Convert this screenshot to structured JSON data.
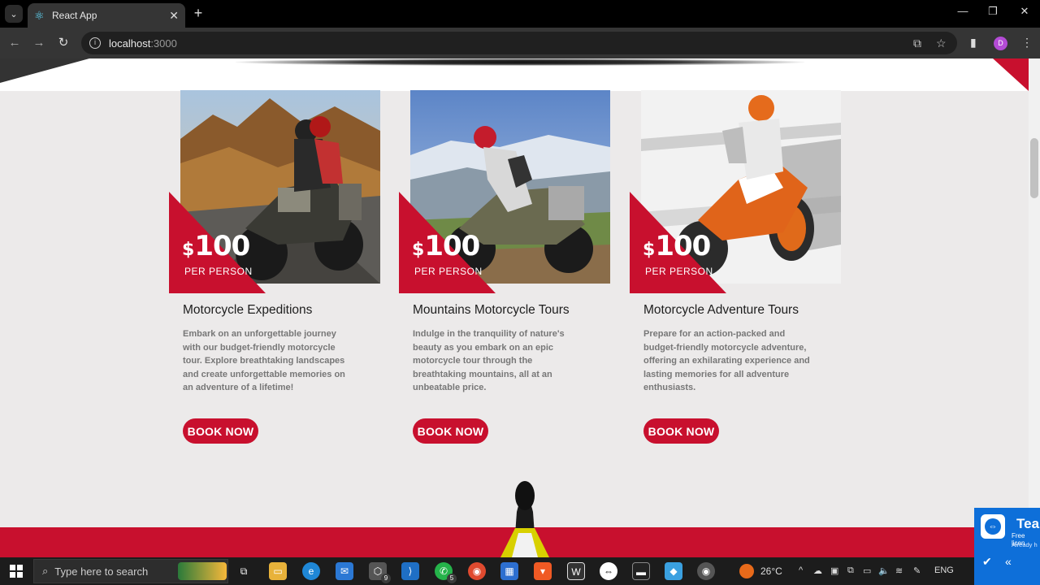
{
  "browser": {
    "tab_title": "React App",
    "url_host": "localhost",
    "url_port": ":3000",
    "profile_initial": "D"
  },
  "cards": [
    {
      "currency": "$",
      "price": "100",
      "per": "PER PERSON",
      "title": "Motorcycle Expeditions",
      "description": "Embark on an unforgettable journey with our budget-friendly motorcycle tour. Explore breathtaking landscapes and create unforgettable memories on an adventure of a lifetime!",
      "button": "BOOK NOW"
    },
    {
      "currency": "$",
      "price": "100",
      "per": "PER PERSON",
      "title": "Mountains Motorcycle Tours",
      "description": "Indulge in the tranquility of nature's beauty as you embark on an epic motorcycle tour through the breathtaking mountains, all at an unbeatable price.",
      "button": "BOOK NOW"
    },
    {
      "currency": "$",
      "price": "100",
      "per": "PER PERSON",
      "title": "Motorcycle Adventure Tours",
      "description": "Prepare for an action-packed and budget-friendly motorcycle adventure, offering an exhilarating experience and lasting memories for all adventure enthusiasts.",
      "button": "BOOK NOW"
    }
  ],
  "colors": {
    "accent": "#c8102e",
    "page_bg": "#eceaea"
  },
  "taskbar": {
    "search_placeholder": "Type here to search",
    "weather": "26°C",
    "language": "ENG",
    "whatsapp_badge": "5",
    "app_badge": "9"
  },
  "teamviewer": {
    "title": "Tea",
    "line1": "Free licen",
    "line2": "Already h"
  }
}
